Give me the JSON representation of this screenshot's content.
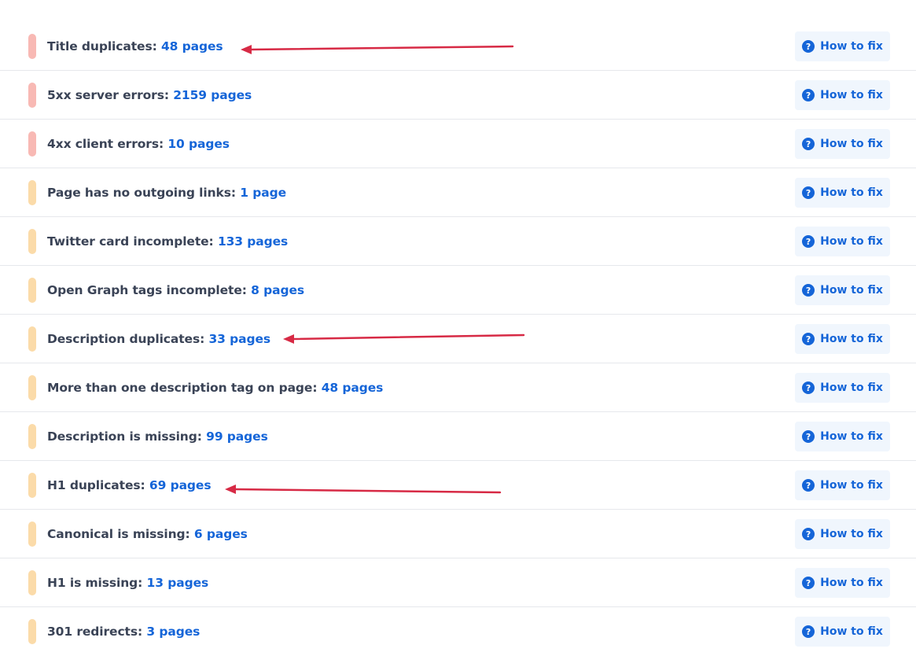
{
  "colors": {
    "critical": "#f8b9b4",
    "warning": "#fbdba9",
    "link": "#1565d8",
    "text": "#3a4356",
    "button_bg": "#f0f6fd",
    "arrow": "#d72a45"
  },
  "icons": {
    "button_icon": "question-circle-icon"
  },
  "fix_label": "How to fix",
  "issues": [
    {
      "label": "Title duplicates: ",
      "count": "48 pages",
      "severity": "critical"
    },
    {
      "label": "5xx server errors: ",
      "count": "2159 pages",
      "severity": "critical"
    },
    {
      "label": "4xx client errors: ",
      "count": "10 pages",
      "severity": "critical"
    },
    {
      "label": "Page has no outgoing links: ",
      "count": "1 page",
      "severity": "warning"
    },
    {
      "label": "Twitter card incomplete: ",
      "count": "133 pages",
      "severity": "warning"
    },
    {
      "label": "Open Graph tags incomplete: ",
      "count": "8 pages",
      "severity": "warning"
    },
    {
      "label": "Description duplicates: ",
      "count": "33 pages",
      "severity": "warning"
    },
    {
      "label": "More than one description tag on page: ",
      "count": "48 pages",
      "severity": "warning"
    },
    {
      "label": "Description is missing: ",
      "count": "99 pages",
      "severity": "warning"
    },
    {
      "label": "H1 duplicates: ",
      "count": "69 pages",
      "severity": "warning"
    },
    {
      "label": "Canonical is missing: ",
      "count": "6 pages",
      "severity": "warning"
    },
    {
      "label": "H1 is missing: ",
      "count": "13 pages",
      "severity": "warning"
    },
    {
      "label": "301 redirects: ",
      "count": "3 pages",
      "severity": "warning"
    }
  ]
}
